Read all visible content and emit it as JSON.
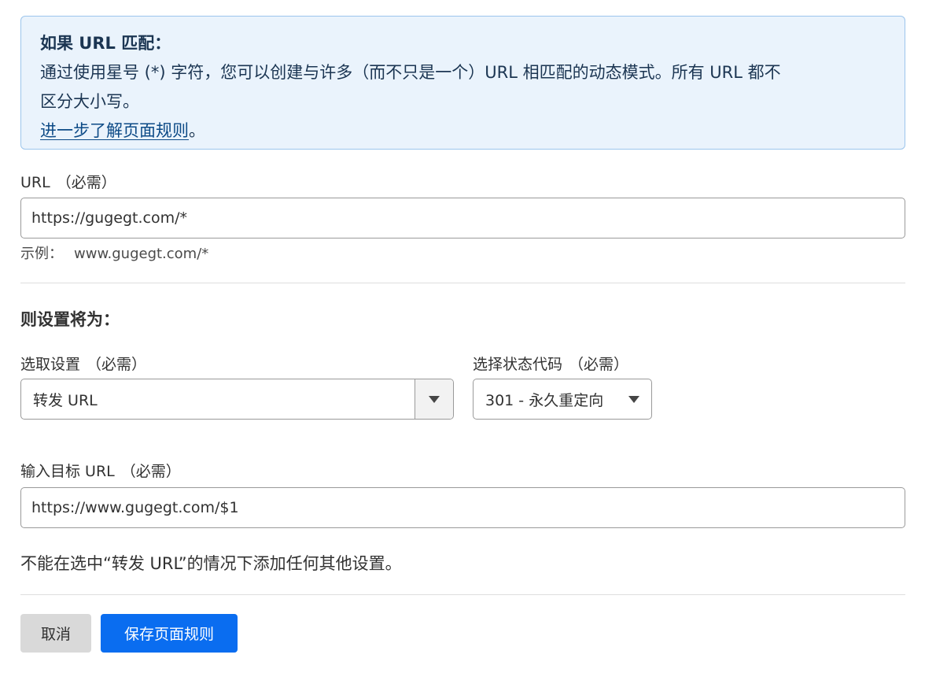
{
  "info": {
    "title": "如果 URL 匹配：",
    "body_line1": "通过使用星号 (*) 字符，您可以创建与许多（而不只是一个）URL 相匹配的动态模式。所有 URL 都不",
    "body_line2": "区分大小写。",
    "link": "进一步了解页面规则",
    "link_suffix": "。"
  },
  "url_field": {
    "label": "URL",
    "required": "（必需）",
    "value": "https://gugegt.com/*",
    "hint_label": "示例：",
    "hint_value": "www.gugegt.com/*"
  },
  "settings": {
    "title": "则设置将为：",
    "setting_select": {
      "label": "选取设置",
      "required": "（必需）",
      "value": "转发 URL"
    },
    "status_select": {
      "label": "选择状态代码",
      "required": "（必需）",
      "value": "301 - 永久重定向"
    },
    "target_url": {
      "label": "输入目标 URL",
      "required": "（必需）",
      "value": "https://www.gugegt.com/$1"
    },
    "notice": "不能在选中“转发 URL”的情况下添加任何其他设置。"
  },
  "actions": {
    "cancel_label": "取消",
    "save_label": "保存页面规则"
  },
  "colors": {
    "info_bg": "#eaf3fc",
    "info_border": "#9cc5ec",
    "primary": "#0a6df0",
    "secondary": "#d9d9d9"
  },
  "icons": {
    "dropdown": "chevron-down-icon"
  }
}
